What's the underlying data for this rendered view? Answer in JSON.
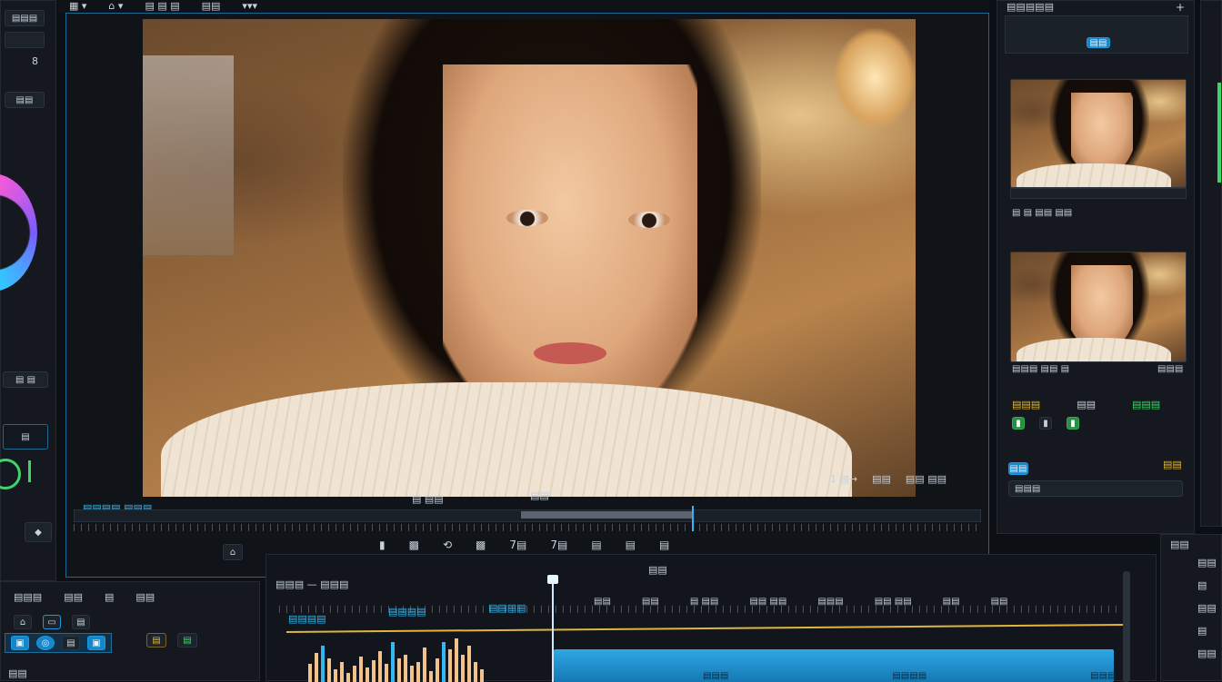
{
  "top_toolbar": {
    "items": [
      "▦ ▾",
      "⌂ ▾",
      "▤ ▤ ▤",
      "▤▤",
      "▾▾▾"
    ]
  },
  "left_panel": {
    "header_label": "▤▤▤",
    "field_value": "8",
    "button_label": "▤▤",
    "bottom_field": "▤ ▤",
    "bottom_field_2": "▤",
    "wheel_colors": [
      "#ff5ad6",
      "#7a5cff",
      "#2ad4ff"
    ]
  },
  "viewer": {
    "timecode_left": "▤▤▤▤ ▤▤▤",
    "timecode_mid": "▤▤",
    "label_mid": "▤ ▤▤",
    "right_controls": [
      "1 ▤→",
      "▤▤",
      "▤▤ ▤▤"
    ],
    "transport": [
      "▮",
      "▩",
      "⟲",
      "▩",
      "7▤",
      "7▤",
      "▤",
      "▤",
      "▤"
    ]
  },
  "right_panel": {
    "header_label": "▤▤▤▤▤",
    "top_button": "▤▤",
    "clip1_label": "▤ ▤ ▤▤ ▤▤",
    "clip2_label": "▤▤▤ ▤▤ ▤",
    "clip2_right": "▤▤▤",
    "meta_left": "▤▤▤",
    "meta_mid": "▤▤",
    "meta_right": "▤▤▤",
    "controls": [
      "▮",
      "▮",
      "▮"
    ],
    "bottom_label": "▤▤",
    "bottom_field": "▤▤▤",
    "bottom_right": "▤▤"
  },
  "bottom_left_panel": {
    "header": "▤▤▤",
    "header_2": "▤▤",
    "header_3": "▤",
    "header_4": "▤▤",
    "icons": [
      "⌂",
      "▭",
      "▤",
      "▣",
      "◎",
      "▤",
      "▣",
      "▤",
      "▤"
    ],
    "footer": "▤▤"
  },
  "timeline": {
    "title": "▤▤▤ — ▤▤▤",
    "center_label": "▤▤",
    "track1_label": "▤▤▤▤",
    "track2_label": "▤▤▤▤",
    "track3_label": "▤▤▤▤",
    "markers": [
      "▤▤",
      "▤▤",
      "▤ ▤▤",
      "▤▤ ▤▤",
      "▤▤▤",
      "▤▤ ▤▤",
      "▤▤",
      "▤▤"
    ],
    "bottom_labels": [
      "▤▤▤",
      "▤▤▤▤",
      "▤▤▤"
    ],
    "colors": {
      "accent": "#33b7f0",
      "yellow": "#e0b53a",
      "audio": "#f2c28a"
    }
  },
  "far_right_panel": {
    "header": "▤▤",
    "values": [
      "▤▤",
      "▤",
      "▤▤",
      "▤",
      "▤▤"
    ]
  }
}
